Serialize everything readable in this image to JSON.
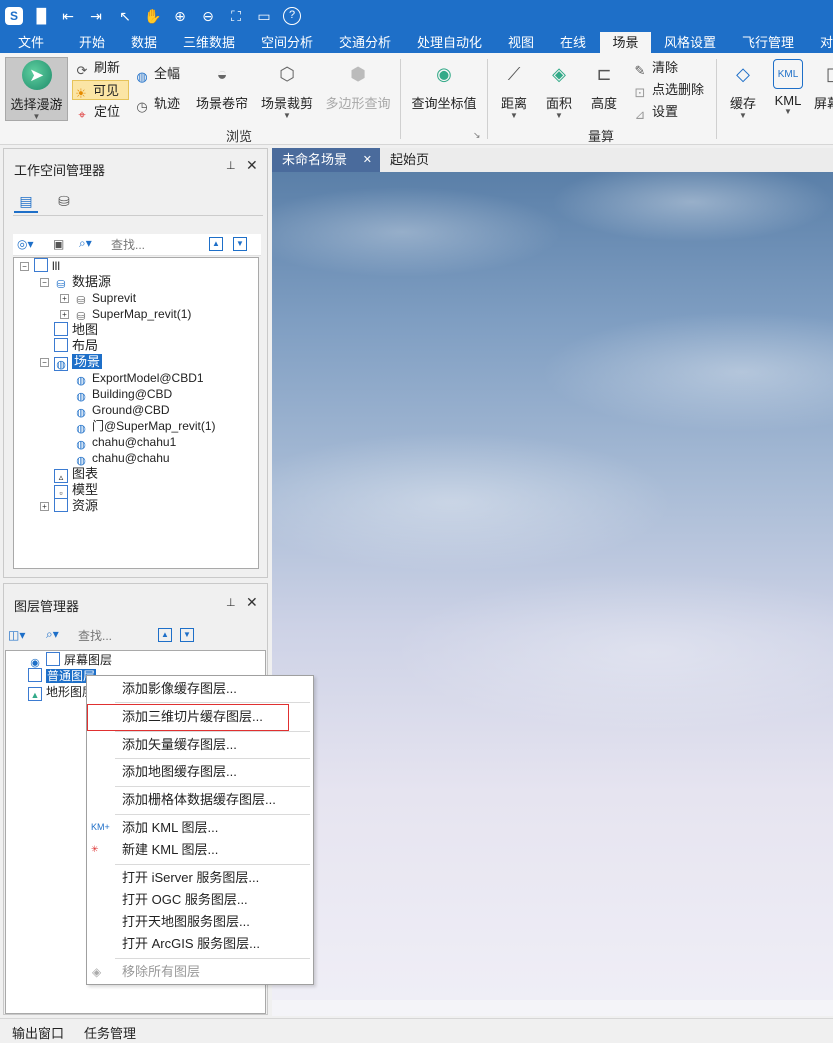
{
  "titlebar": {
    "icons": [
      "app-logo-icon",
      "save-icon",
      "undo-icon",
      "redo-icon",
      "pointer-icon",
      "pan-hand-icon",
      "zoom-in-icon",
      "zoom-out-icon",
      "full-extent-icon",
      "open-folder-icon",
      "help-icon"
    ]
  },
  "menubar": {
    "tabs": [
      "文件",
      "开始",
      "数据",
      "三维数据",
      "空间分析",
      "交通分析",
      "处理自动化",
      "视图",
      "在线",
      "场景",
      "风格设置",
      "飞行管理",
      "对"
    ],
    "active": "场景"
  },
  "ribbon": {
    "browse": {
      "select_roam": "选择漫游",
      "refresh": "刷新",
      "visible": "可见",
      "locate": "定位",
      "full_extent": "全幅",
      "track": "轨迹",
      "scene_shutter": "场景卷帘",
      "scene_clip": "场景裁剪",
      "polygon_query": "多边形查询",
      "query_coord": "查询坐标值",
      "group_label": "浏览"
    },
    "measure": {
      "distance": "距离",
      "area": "面积",
      "height": "高度",
      "clear": "清除",
      "point_delete": "点选删除",
      "settings": "设置",
      "group_label": "量算"
    },
    "other": {
      "cache": "缓存",
      "kml": "KML",
      "kml_icon_text": "KML",
      "screen": "屏幕"
    }
  },
  "workspace": {
    "title": "工作空间管理器",
    "search_placeholder": "查找...",
    "root": "lll",
    "datasource": "数据源",
    "ds_items": [
      "Suprevit",
      "SuperMap_revit(1)"
    ],
    "map": "地图",
    "layout": "布局",
    "scene": "场景",
    "scene_items": [
      "ExportModel@CBD1",
      "Building@CBD",
      "Ground@CBD",
      "门@SuperMap_revit(1)",
      "chahu@chahu1",
      "chahu@chahu"
    ],
    "chart": "图表",
    "model": "模型",
    "resource": "资源"
  },
  "layers": {
    "title": "图层管理器",
    "search_placeholder": "查找...",
    "items": [
      "屏幕图层",
      "普通图层",
      "地形图层"
    ]
  },
  "context_menu": {
    "items": [
      "添加影像缓存图层...",
      "添加三维切片缓存图层...",
      "添加矢量缓存图层...",
      "添加地图缓存图层...",
      "添加栅格体数据缓存图层...",
      "添加 KML 图层...",
      "新建 KML 图层...",
      "打开 iServer 服务图层...",
      "打开 OGC 服务图层...",
      "打开天地图服务图层...",
      "打开 ArcGIS 服务图层...",
      "移除所有图层"
    ],
    "highlighted_index": 1,
    "highlight_color": "#e03030"
  },
  "document_tabs": {
    "active": "未命名场景",
    "other": "起始页"
  },
  "statusbar": {
    "output": "输出窗口",
    "tasks": "任务管理"
  },
  "colors": {
    "accent": "#1e6fc8",
    "selection": "#1e6fc8"
  }
}
